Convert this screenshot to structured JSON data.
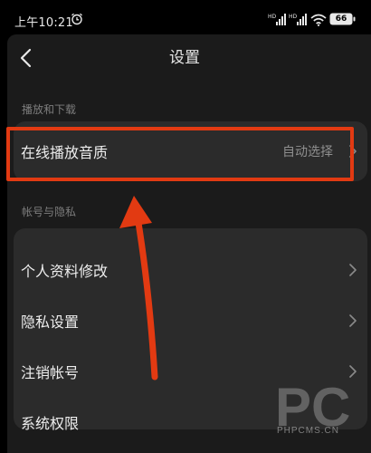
{
  "status_bar": {
    "time": "上午10:21",
    "network_1": "HD",
    "network_2": "HD",
    "battery": "66"
  },
  "header": {
    "title": "设置"
  },
  "sections": [
    {
      "header": "播放和下载",
      "items": [
        {
          "label": "在线播放音质",
          "value": "自动选择"
        }
      ]
    },
    {
      "header": "帐号与隐私",
      "items": [
        {
          "label": "个人资料修改"
        },
        {
          "label": "隐私设置"
        },
        {
          "label": "注销帐号"
        },
        {
          "label": "系统权限"
        }
      ]
    }
  ],
  "watermark": {
    "logo_text": "PC",
    "site": "PHPCMS.CN"
  },
  "colors": {
    "background": "#1b1b1b",
    "card": "#2b2b2b",
    "annotation": "#e23a12"
  },
  "icons": [
    "alarm-icon",
    "signal-icon",
    "wifi-icon",
    "battery-icon",
    "back-arrow-icon",
    "chevron-right-icon"
  ]
}
